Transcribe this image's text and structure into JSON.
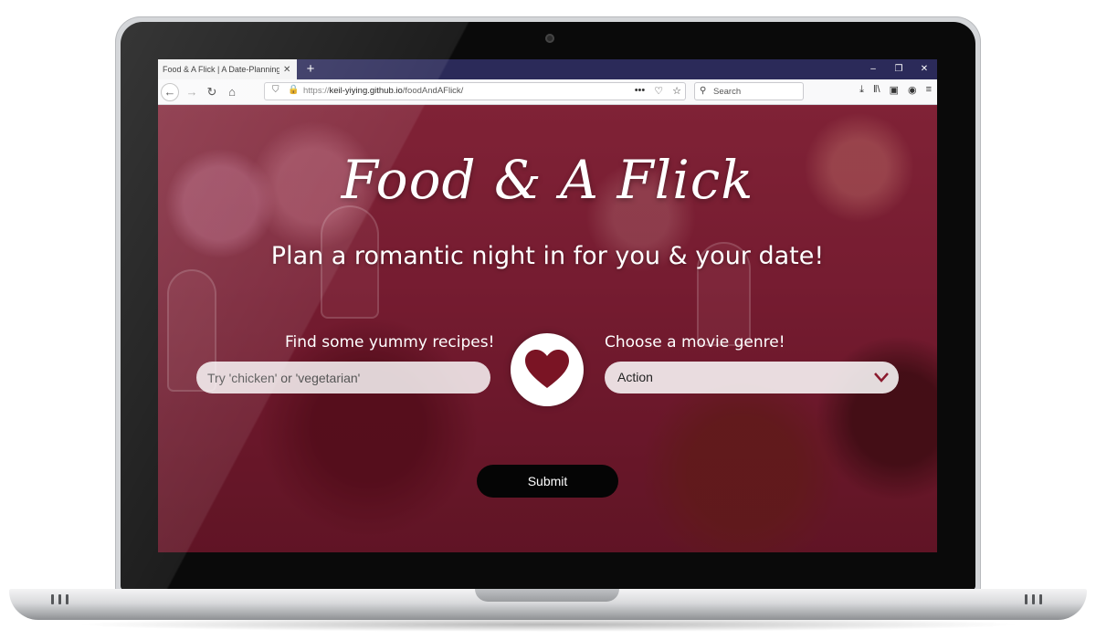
{
  "browser": {
    "tab_title": "Food & A Flick | A Date-Planning A",
    "tab_close": "✕",
    "new_tab": "+",
    "window_minimize": "–",
    "window_restore": "❐",
    "window_close": "✕",
    "url_protocol": "https://",
    "url_host": "keil-yiying.github.io",
    "url_path": "/foodAndAFlick/",
    "search_placeholder": "Search",
    "more_icon": "•••"
  },
  "page": {
    "title": "Food & A Flick",
    "subtitle": "Plan a romantic night in for you & your date!",
    "recipe_label": "Find some yummy recipes!",
    "recipe_placeholder": "Try 'chicken' or 'vegetarian'",
    "movie_label": "Choose a movie genre!",
    "genre_selected": "Action",
    "submit_label": "Submit"
  },
  "colors": {
    "accent": "#8b1a2e",
    "tab_strip": "#2b2a59"
  }
}
